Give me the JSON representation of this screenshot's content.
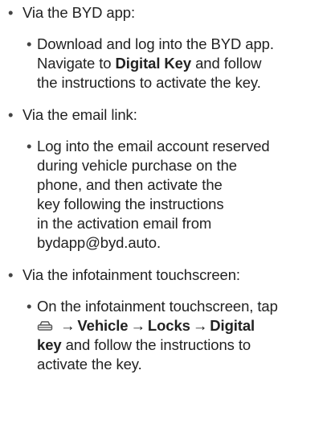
{
  "section1": {
    "bullet": "•",
    "title": "Via the BYD app:",
    "sub": {
      "bullet": "•",
      "line1": "Download and log into the BYD app.",
      "line2_pre": "Navigate to ",
      "line2_bold": "Digital Key",
      "line2_post": " and follow",
      "line3": "the instructions to activate the key."
    }
  },
  "section2": {
    "bullet": "•",
    "title": "Via the email link:",
    "sub": {
      "bullet": "•",
      "lines": [
        "Log into the email account reserved",
        "during vehicle purchase on the",
        "phone, and then activate the",
        "key following the instructions",
        "in the activation email from",
        "bydapp@byd.auto."
      ]
    }
  },
  "section3": {
    "bullet": "•",
    "title": "Via the infotainment touchscreen:",
    "sub": {
      "bullet": "•",
      "line1": "On the infotainment touchscreen, tap",
      "icon": "car-icon",
      "arrow": "→",
      "vehicle": "Vehicle",
      "locks": "Locks",
      "digital": "Digital",
      "line3_bold": "key",
      "line3_post": " and follow the instructions to",
      "line4": "activate the key."
    }
  }
}
